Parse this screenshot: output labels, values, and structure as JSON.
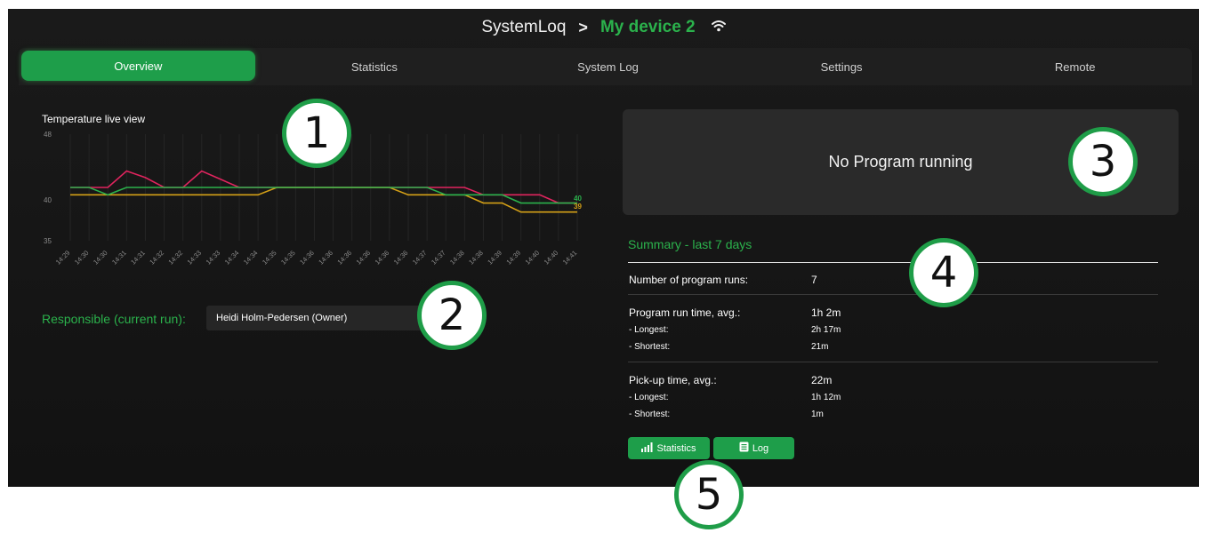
{
  "header": {
    "app_name": "SystemLoq",
    "separator": ">",
    "device_name": "My device 2"
  },
  "tabs": [
    {
      "label": "Overview",
      "active": true
    },
    {
      "label": "Statistics",
      "active": false
    },
    {
      "label": "System Log",
      "active": false
    },
    {
      "label": "Settings",
      "active": false
    },
    {
      "label": "Remote",
      "active": false
    }
  ],
  "chart_data": {
    "type": "line",
    "title": "Temperature live view",
    "ylim": [
      35,
      48
    ],
    "y_ticks": [
      48,
      40,
      35
    ],
    "categories": [
      "14:29",
      "14:30",
      "14:30",
      "14:31",
      "14:31",
      "14:32",
      "14:32",
      "14:33",
      "14:33",
      "14:34",
      "14:34",
      "14:35",
      "14:35",
      "14:36",
      "14:36",
      "14:36",
      "14:36",
      "14:36",
      "14:36",
      "14:37",
      "14:37",
      "14:38",
      "14:38",
      "14:39",
      "14:39",
      "14:40",
      "14:40",
      "14:41"
    ],
    "series": [
      {
        "color": "#e0245e",
        "values": [
          41.5,
          41.5,
          41.5,
          43.5,
          42.7,
          41.5,
          41.5,
          43.5,
          42.5,
          41.5,
          41.5,
          41.5,
          41.5,
          41.5,
          41.5,
          41.5,
          41.5,
          41.5,
          41.5,
          41.5,
          41.5,
          41.5,
          40.6,
          40.6,
          40.6,
          40.6,
          39.6,
          39.6
        ]
      },
      {
        "color": "#d4a017",
        "values": [
          40.6,
          40.6,
          40.6,
          40.6,
          40.6,
          40.6,
          40.6,
          40.6,
          40.6,
          40.6,
          40.6,
          41.5,
          41.5,
          41.5,
          41.5,
          41.5,
          41.5,
          41.5,
          40.6,
          40.6,
          40.6,
          40.6,
          39.6,
          39.6,
          38.5,
          38.5,
          38.5,
          38.5
        ]
      },
      {
        "color": "#2bb24c",
        "values": [
          41.5,
          41.5,
          40.6,
          41.5,
          41.5,
          41.5,
          41.5,
          41.5,
          41.5,
          41.5,
          41.5,
          41.5,
          41.5,
          41.5,
          41.5,
          41.5,
          41.5,
          41.5,
          41.5,
          41.5,
          40.6,
          40.6,
          40.6,
          40.6,
          39.6,
          39.6,
          39.6,
          39.6
        ]
      }
    ],
    "end_labels": [
      {
        "text": "40",
        "color": "#2bb24c"
      },
      {
        "text": "39",
        "color": "#d4a017"
      }
    ]
  },
  "responsible": {
    "label": "Responsible (current run):",
    "value": "Heidi Holm-Pedersen (Owner)"
  },
  "status": {
    "text": "No Program running"
  },
  "summary": {
    "title": "Summary - last 7 days",
    "program_runs_label": "Number of program runs:",
    "program_runs_value": "7",
    "run_time_label": "Program run time, avg.:",
    "run_time_value": "1h 2m",
    "run_longest_label": "- Longest:",
    "run_longest_value": "2h 17m",
    "run_shortest_label": "- Shortest:",
    "run_shortest_value": "21m",
    "pickup_label": "Pick-up time, avg.:",
    "pickup_value": "22m",
    "pickup_longest_label": "- Longest:",
    "pickup_longest_value": "1h 12m",
    "pickup_shortest_label": "- Shortest:",
    "pickup_shortest_value": "1m"
  },
  "buttons": {
    "statistics": "Statistics",
    "log": "Log"
  },
  "callouts": [
    "1",
    "2",
    "3",
    "4",
    "5"
  ],
  "colors": {
    "accent": "#2bb24c",
    "accent_dark": "#1e9e4a",
    "background": "#141414",
    "panel": "#2a2a2a"
  }
}
